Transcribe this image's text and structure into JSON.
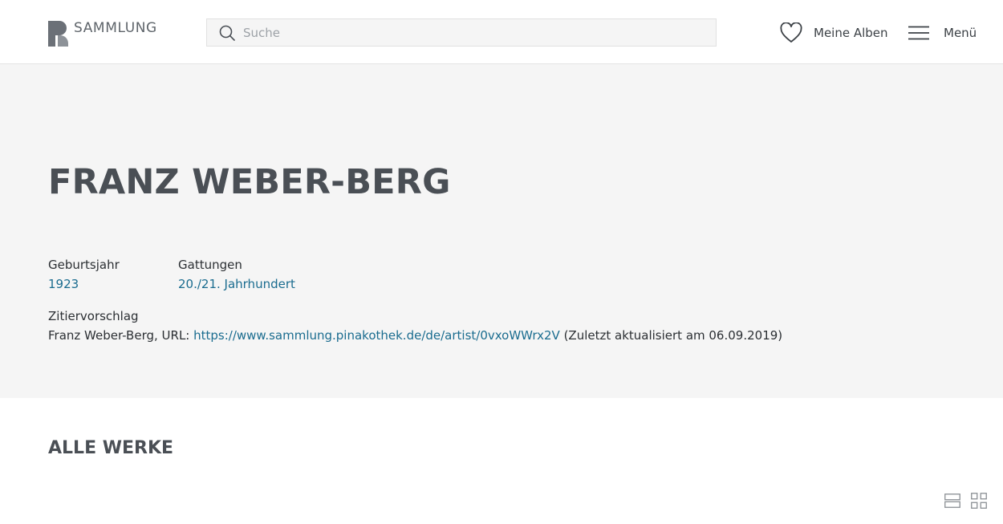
{
  "header": {
    "logo_text": "SAMMLUNG",
    "search_placeholder": "Suche",
    "albums_label": "Meine Alben",
    "menu_label": "Menü"
  },
  "artist": {
    "name": "FRANZ WEBER-BERG",
    "birth_label": "Geburtsjahr",
    "birth_value": "1923",
    "genre_label": "Gattungen",
    "genre_value": "20./21. Jahrhundert",
    "citation_label": "Zitiervorschlag",
    "citation_prefix": "Franz Weber-Berg, URL: ",
    "citation_url": "https://www.sammlung.pinakothek.de/de/artist/0vxoWWrx2V",
    "citation_suffix": " (Zuletzt aktualisiert am 06.09.2019)"
  },
  "works": {
    "title": "ALLE WERKE"
  },
  "icons": {
    "logo": "pinakothek-logo-icon",
    "search": "search-icon",
    "albums": "heart-icon",
    "menu": "hamburger-icon",
    "list_view": "list-view-icon",
    "grid_view": "grid-view-icon"
  },
  "colors": {
    "link": "#1a6c8f",
    "heading": "#4a4f55",
    "hero_background": "#f5f5f5"
  }
}
